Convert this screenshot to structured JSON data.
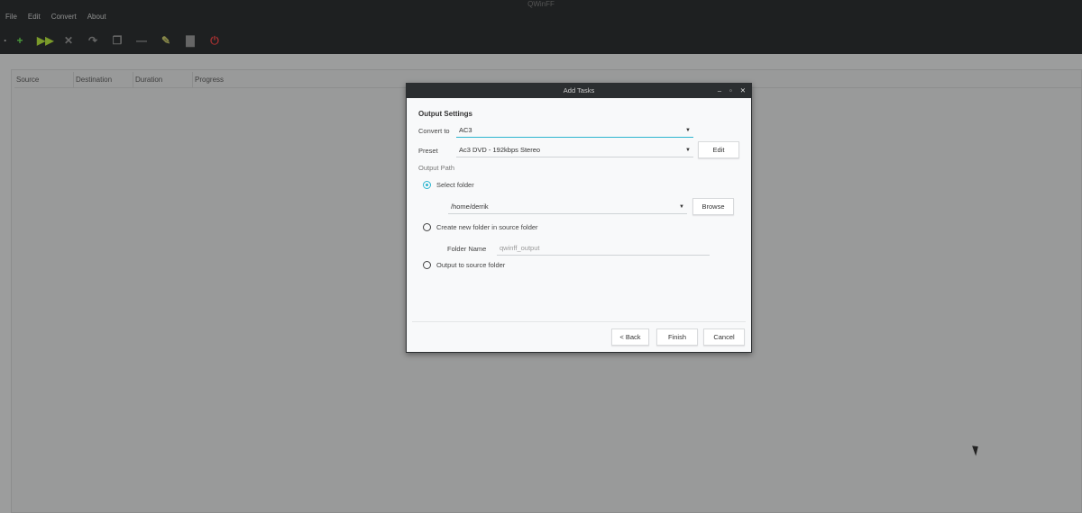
{
  "app": {
    "title": "QWinFF"
  },
  "menu": [
    "File",
    "Edit",
    "Convert",
    "About"
  ],
  "toolbar": [
    {
      "icon": "add-icon",
      "glyph": "+",
      "color": "#4a9a3a"
    },
    {
      "icon": "start-icon",
      "glyph": "▶▶",
      "color": "#7a9a2a"
    },
    {
      "icon": "stop-icon",
      "glyph": "✕",
      "color": "#666"
    },
    {
      "icon": "redo-icon",
      "glyph": "↷",
      "color": "#666"
    },
    {
      "icon": "copy-icon",
      "glyph": "❐",
      "color": "#666"
    },
    {
      "icon": "remove-icon",
      "glyph": "—",
      "color": "#666"
    },
    {
      "icon": "clear-icon",
      "glyph": "✎",
      "color": "#8a8a4a"
    },
    {
      "icon": "clipboard-icon",
      "glyph": "▇",
      "color": "#666"
    },
    {
      "icon": "power-icon",
      "glyph": "⏻",
      "color": "#a03030"
    }
  ],
  "table": {
    "columns": [
      "Source",
      "Destination",
      "Duration",
      "Progress"
    ]
  },
  "dialog": {
    "title": "Add Tasks",
    "section": "Output Settings",
    "convert_label": "Convert to",
    "convert_value": "AC3",
    "preset_label": "Preset",
    "preset_value": "Ac3 DVD - 192kbps Stereo",
    "edit": "Edit",
    "output_path": "Output Path",
    "select_folder": "Select folder",
    "folder_value": "/home/derrik",
    "browse": "Browse",
    "new_folder": "Create new folder in source folder",
    "folder_name_label": "Folder Name",
    "folder_name_placeholder": "qwinff_output",
    "source_folder": "Output to source folder",
    "back": "< Back",
    "finish": "Finish",
    "cancel": "Cancel"
  },
  "accent": "#2cb5cf"
}
